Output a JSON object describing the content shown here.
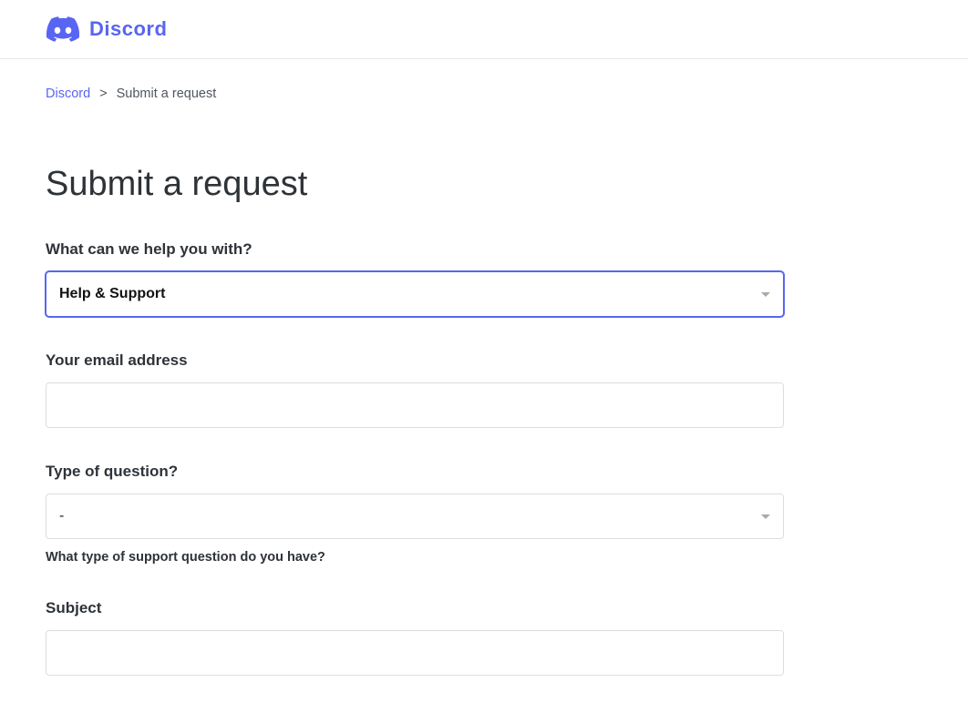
{
  "header": {
    "brand": "Discord"
  },
  "breadcrumb": {
    "home": "Discord",
    "current": "Submit a request",
    "separator": ">"
  },
  "title": "Submit a request",
  "form": {
    "help_with": {
      "label": "What can we help you with?",
      "value": "Help & Support"
    },
    "email": {
      "label": "Your email address",
      "value": ""
    },
    "question_type": {
      "label": "Type of question?",
      "value": "-",
      "hint": "What type of support question do you have?"
    },
    "subject": {
      "label": "Subject",
      "value": ""
    }
  }
}
